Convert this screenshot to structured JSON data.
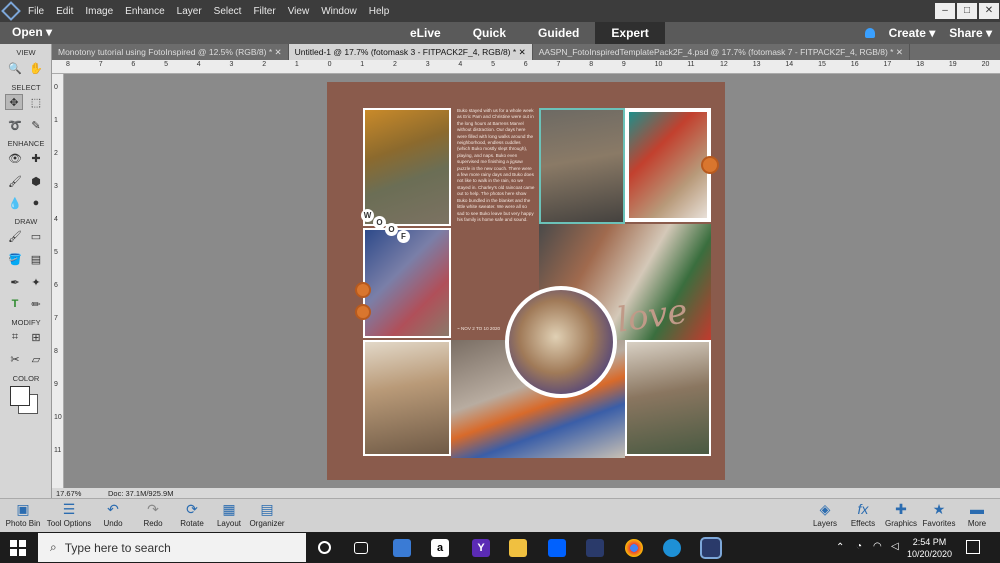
{
  "menubar": {
    "items": [
      "File",
      "Edit",
      "Image",
      "Enhance",
      "Layer",
      "Select",
      "Filter",
      "View",
      "Window",
      "Help"
    ],
    "window_controls": [
      "–",
      "□",
      "✕"
    ]
  },
  "modebar": {
    "open_label": "Open",
    "modes": [
      "eLive",
      "Quick",
      "Guided",
      "Expert"
    ],
    "active_mode": "Expert",
    "create_label": "Create",
    "share_label": "Share"
  },
  "tabs": [
    {
      "label": "Monotony tutorial using FotoInspired @ 12.5% (RGB/8) *",
      "active": false
    },
    {
      "label": "Untitled-1 @ 17.7% (fotomask 3 - FITPACK2F_4, RGB/8) *",
      "active": true
    },
    {
      "label": "AASPN_FotoInspiredTemplatePack2F_4.psd @ 17.7% (fotomask 7 - FITPACK2F_4, RGB/8) *",
      "active": false
    }
  ],
  "toolbox": {
    "sections": [
      "VIEW",
      "SELECT",
      "ENHANCE",
      "DRAW",
      "MODIFY",
      "COLOR"
    ]
  },
  "ruler": {
    "h_ticks": [
      "8",
      "7",
      "6",
      "5",
      "4",
      "3",
      "2",
      "1",
      "0",
      "1",
      "2",
      "3",
      "4",
      "5",
      "6",
      "7",
      "8",
      "9",
      "10",
      "11",
      "12",
      "13",
      "14",
      "15",
      "16",
      "17",
      "18",
      "19",
      "20"
    ],
    "v_ticks": [
      "0",
      "1",
      "2",
      "3",
      "4",
      "5",
      "6",
      "7",
      "8",
      "9",
      "10",
      "11"
    ]
  },
  "document": {
    "journal_text": "Buko stayed with us for a whole week as Eric Pam and Christine were out in the long hours at Barrens Marvel without distraction. Our days here were filled with long walks around the neighborhood, endless cuddles (which Buko mostly slept through), playing, and naps. Buko even supervised me finishing a jigsaw puzzle in the new couch. There were a few more rainy days and Buko does not like to walk in the rain, so we stayed in. Charley's old raincoat came out to help. The photos here show Buko bundled in the blanket and the little white sweater. We were all so sad to see Buko leave but very happy his family is home safe and sound.",
    "journal_footer": "~ NOV 2 TO 10 2020",
    "woof_letters": [
      "W",
      "O",
      "O",
      "F"
    ],
    "title_word": "love"
  },
  "status": {
    "zoom": "17.67%",
    "doc_info": "Doc: 37.1M/925.9M"
  },
  "bottombar": {
    "left": [
      "Photo Bin",
      "Tool Options",
      "Undo",
      "Redo",
      "Rotate",
      "Layout",
      "Organizer"
    ],
    "right": [
      "Layers",
      "Effects",
      "Graphics",
      "Favorites",
      "More"
    ]
  },
  "taskbar": {
    "search_placeholder": "Type here to search",
    "time": "2:54 PM",
    "date": "10/20/2020"
  },
  "colors": {
    "page_brown": "#8a5b4c",
    "accent_blue": "#2b6cb0"
  }
}
